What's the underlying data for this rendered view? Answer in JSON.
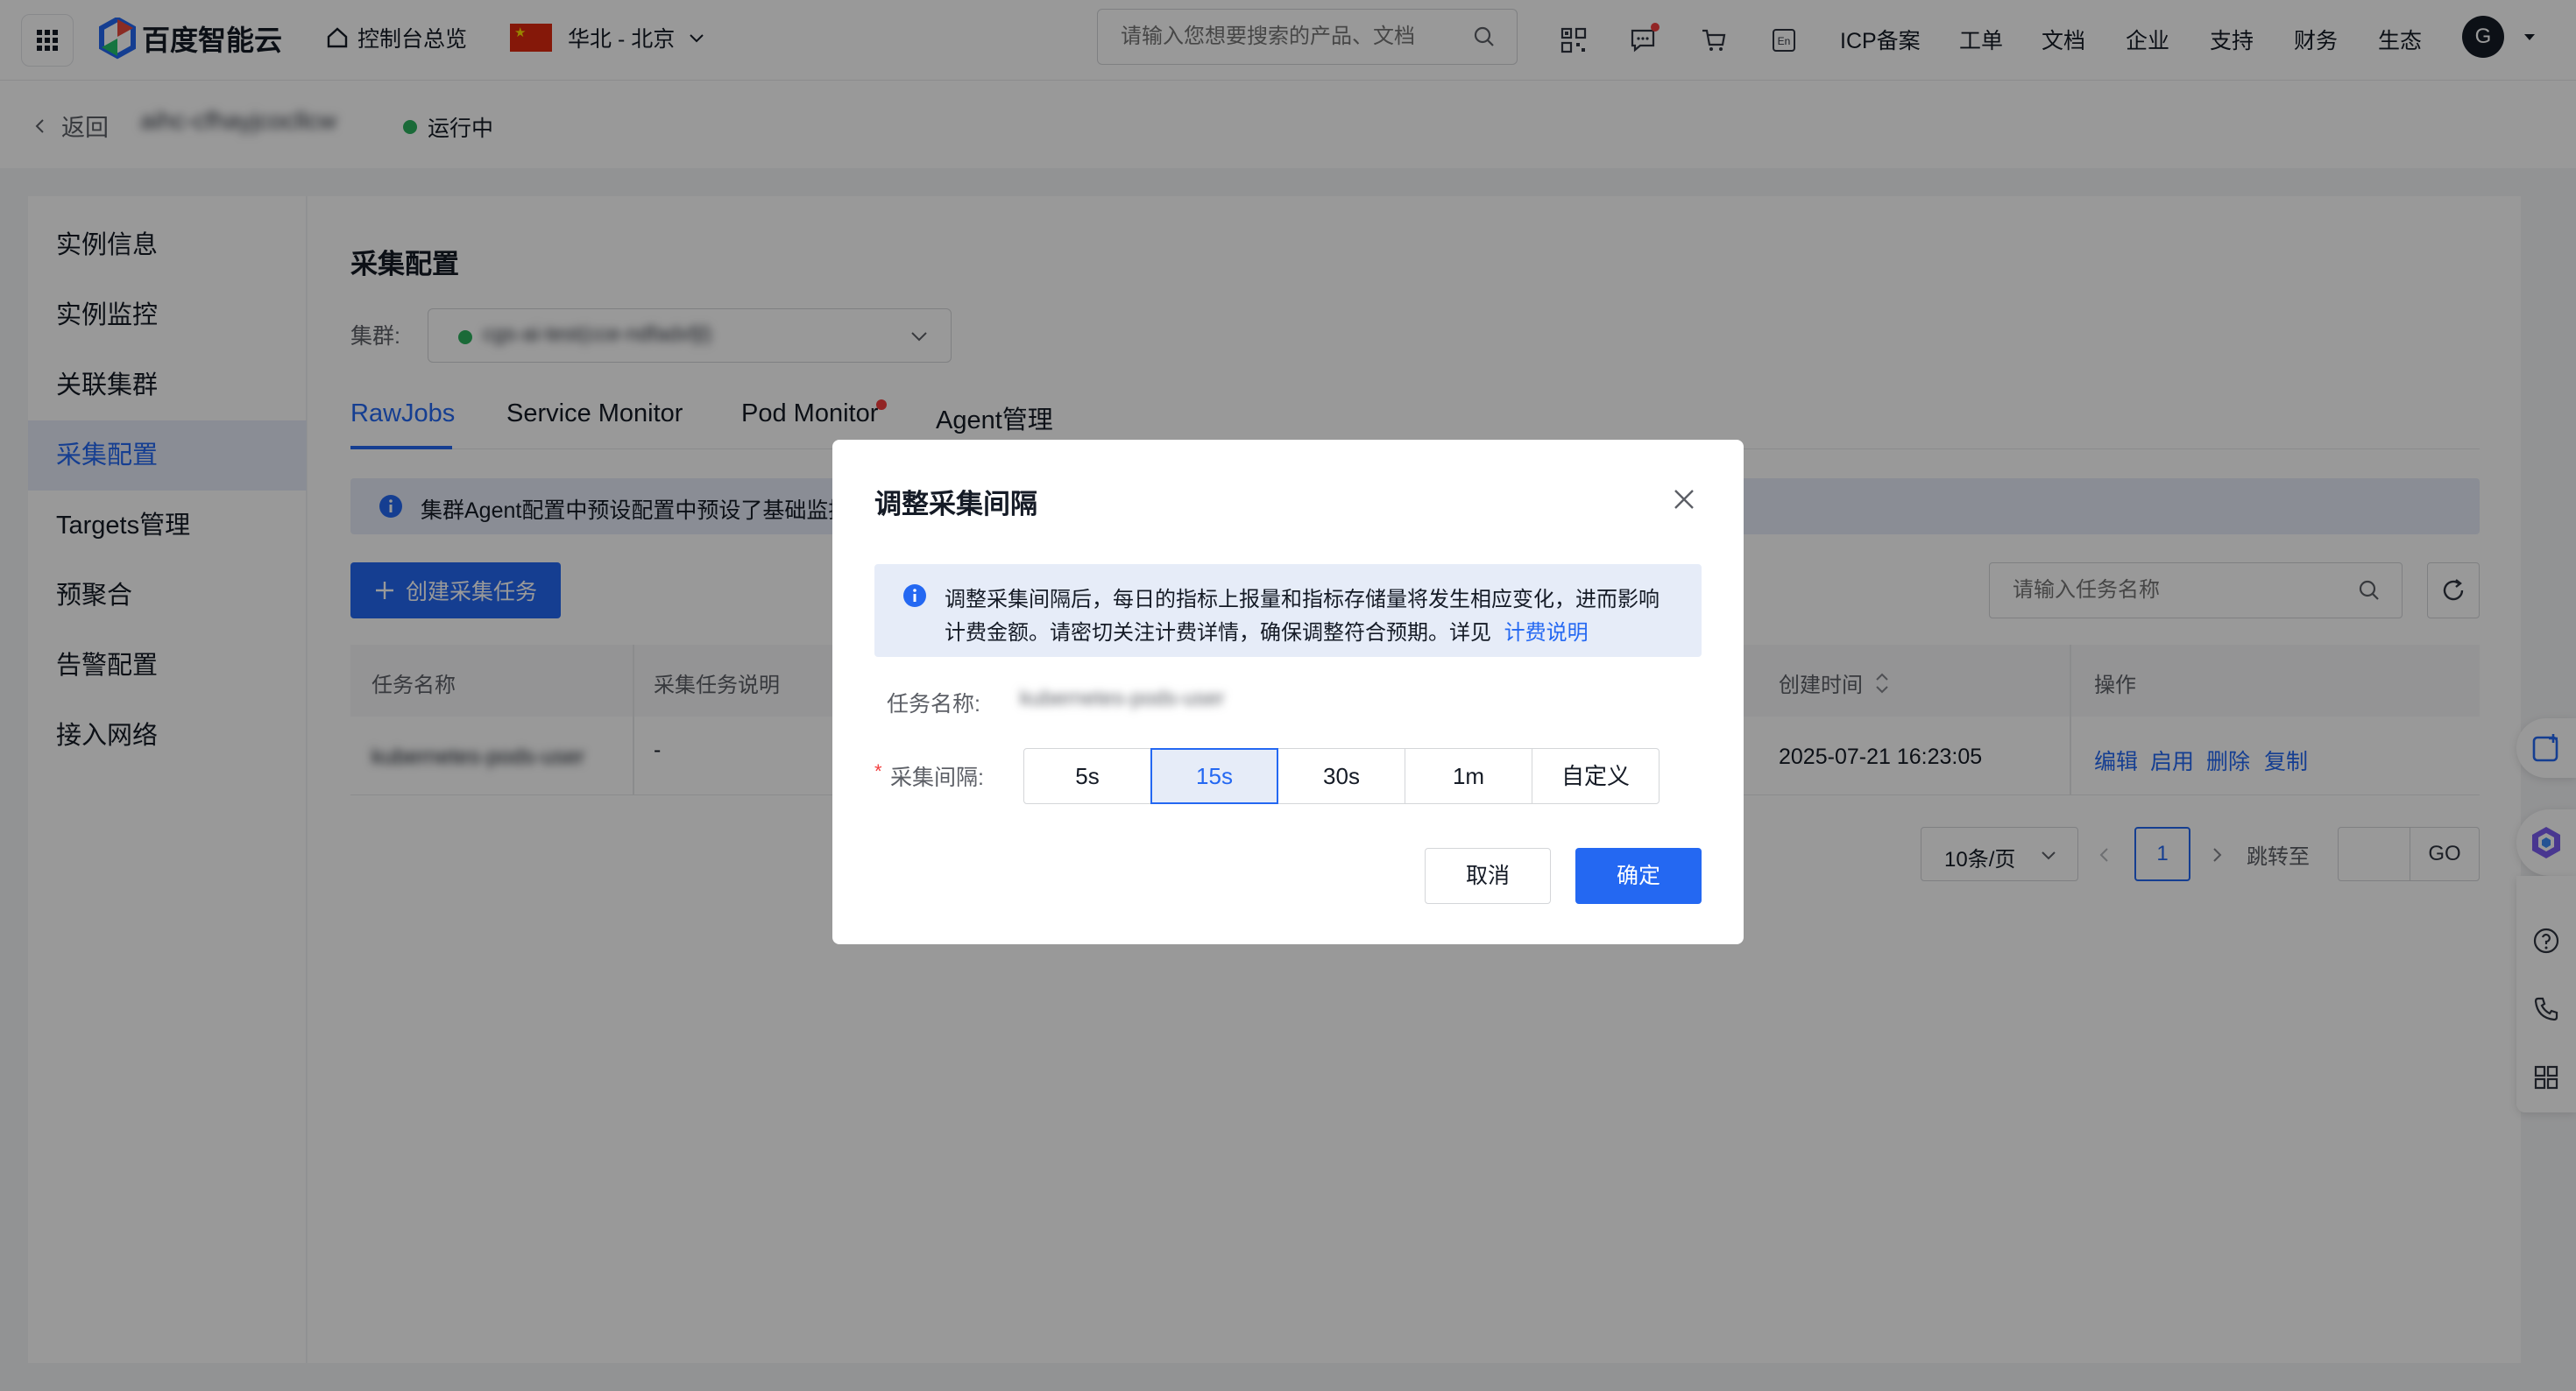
{
  "topbar": {
    "logo_text": "百度智能云",
    "console_label": "控制台总览",
    "region_label": "华北 - 北京",
    "search_placeholder": "请输入您想要搜索的产品、文档",
    "nav": [
      "ICP备案",
      "工单",
      "文档",
      "企业",
      "支持",
      "财务",
      "生态"
    ],
    "avatar_letter": "G"
  },
  "subheader": {
    "back_label": "返回",
    "instance_name": "aihc-cfhayjcocllcw",
    "status": "运行中",
    "status_color": "#2cb15e"
  },
  "sidebar": {
    "items": [
      "实例信息",
      "实例监控",
      "关联集群",
      "采集配置",
      "Targets管理",
      "预聚合",
      "告警配置",
      "接入网络"
    ],
    "active_index": 3
  },
  "main": {
    "title": "采集配置",
    "cluster_label": "集群:",
    "cluster_value": "cgs-ai-test(cce-ndfadxfjl)",
    "tabs": [
      "RawJobs",
      "Service Monitor",
      "Pod Monitor",
      "Agent管理"
    ],
    "active_tab": 0,
    "info_text": "集群Agent配置中预设配置中预设了基础监控",
    "create_button": "创建采集任务",
    "search_placeholder": "请输入任务名称",
    "table": {
      "headers": [
        "任务名称",
        "采集任务说明",
        "创建时间",
        "操作"
      ],
      "rows": [
        {
          "name": "kubernetes-pods-user",
          "desc": "-",
          "created": "2025-07-21 16:23:05",
          "actions": [
            "编辑",
            "启用",
            "删除",
            "复制"
          ]
        }
      ]
    },
    "pagination": {
      "page_size": "10条/页",
      "current_page": "1",
      "jump_label": "跳转至",
      "go_label": "GO"
    }
  },
  "modal": {
    "title": "调整采集间隔",
    "notice_line1": "调整采集间隔后，每日的指标上报量和指标存储量将发生相应变化，进而影响",
    "notice_line2": "计费金额。请密切关注计费详情，确保调整符合预期。详见",
    "notice_link": "计费说明",
    "task_label": "任务名称:",
    "task_value": "kubernetes-pods-user",
    "interval_label": "采集间隔:",
    "required_mark": "*",
    "options": [
      "5s",
      "15s",
      "30s",
      "1m",
      "自定义"
    ],
    "selected_option": "15s",
    "cancel_label": "取消",
    "confirm_label": "确定"
  },
  "colors": {
    "primary": "#2468f2",
    "active_bg": "#e6ecf8",
    "success": "#2cb15e",
    "alert_dot": "#f33e3e"
  }
}
